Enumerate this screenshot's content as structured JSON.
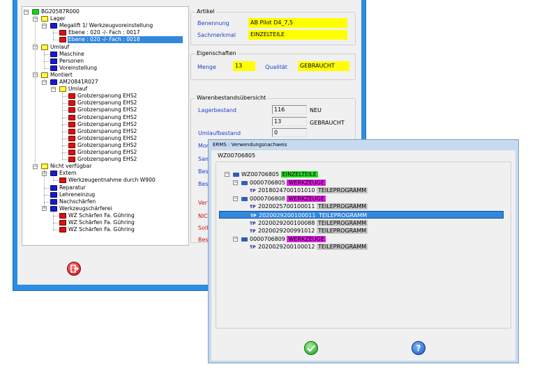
{
  "main": {
    "tree": {
      "items": [
        {
          "label": "BG20587R000",
          "indent": 0,
          "color": "g",
          "exp": "−"
        },
        {
          "label": "Lager",
          "indent": 1,
          "color": "y",
          "exp": "−"
        },
        {
          "label": "Megalift 1/ Werkzeugvoreinstellung",
          "indent": 2,
          "color": "b",
          "exp": "−"
        },
        {
          "label": "Ebene : 020 -/- Fach : 0017",
          "indent": 3,
          "color": "r",
          "exp": ""
        },
        {
          "label": "Ebene : 020 -/- Fach : 0018",
          "indent": 3,
          "color": "r",
          "exp": "",
          "selected": true
        },
        {
          "label": "Umlauf",
          "indent": 1,
          "color": "y",
          "exp": "−"
        },
        {
          "label": "Maschine",
          "indent": 2,
          "color": "b",
          "exp": ""
        },
        {
          "label": "Personen",
          "indent": 2,
          "color": "b",
          "exp": ""
        },
        {
          "label": "Voreinstellung",
          "indent": 2,
          "color": "b",
          "exp": ""
        },
        {
          "label": "Montiert",
          "indent": 1,
          "color": "y",
          "exp": "−"
        },
        {
          "label": "AM20841R027",
          "indent": 2,
          "color": "b",
          "exp": "−"
        },
        {
          "label": "Umlauf",
          "indent": 3,
          "color": "y",
          "exp": "−"
        },
        {
          "label": "Grobzerspanung EHS2",
          "indent": 4,
          "color": "r",
          "exp": ""
        },
        {
          "label": "Grobzerspanung EHS2",
          "indent": 4,
          "color": "r",
          "exp": ""
        },
        {
          "label": "Grobzerspanung EHS2",
          "indent": 4,
          "color": "r",
          "exp": ""
        },
        {
          "label": "Grobzerspanung EHS2",
          "indent": 4,
          "color": "r",
          "exp": ""
        },
        {
          "label": "Grobzerspanung EHS2",
          "indent": 4,
          "color": "r",
          "exp": ""
        },
        {
          "label": "Grobzerspanung EHS2",
          "indent": 4,
          "color": "r",
          "exp": ""
        },
        {
          "label": "Grobzerspanung EHS2",
          "indent": 4,
          "color": "r",
          "exp": ""
        },
        {
          "label": "Grobzerspanung EHS2",
          "indent": 4,
          "color": "r",
          "exp": ""
        },
        {
          "label": "Grobzerspanung EHS2",
          "indent": 4,
          "color": "r",
          "exp": ""
        },
        {
          "label": "Grobzerspanung EHS2",
          "indent": 4,
          "color": "r",
          "exp": ""
        },
        {
          "label": "Nicht verfügbar",
          "indent": 1,
          "color": "y",
          "exp": "−"
        },
        {
          "label": "Extern",
          "indent": 2,
          "color": "b",
          "exp": "−"
        },
        {
          "label": "Werkzeugentnahme durch W900",
          "indent": 3,
          "color": "r",
          "exp": ""
        },
        {
          "label": "Reparatur",
          "indent": 2,
          "color": "b",
          "exp": ""
        },
        {
          "label": "Lehreneinzug",
          "indent": 2,
          "color": "b",
          "exp": ""
        },
        {
          "label": "Nachschärfen",
          "indent": 2,
          "color": "b",
          "exp": ""
        },
        {
          "label": "Werkzeugschärferei",
          "indent": 2,
          "color": "b",
          "exp": "−"
        },
        {
          "label": "WZ Schärfen Fa. Gühring",
          "indent": 3,
          "color": "r",
          "exp": ""
        },
        {
          "label": "WZ Schärfen Fa. Gühring",
          "indent": 3,
          "color": "r",
          "exp": ""
        },
        {
          "label": "WZ Schärfen Fa. Gühring",
          "indent": 3,
          "color": "r",
          "exp": ""
        }
      ]
    },
    "artikel": {
      "title": "Artikel",
      "benennung_label": "Benennung",
      "benennung_value": "AB Pilot D4_7,5",
      "sachmerkmal_label": "Sachmerkmal",
      "sachmerkmal_value": "EINZELTEILE"
    },
    "eigenschaften": {
      "title": "Eigenschaften",
      "menge_label": "Menge",
      "menge_value": "13",
      "qualitaet_label": "Qualität",
      "qualitaet_value": "GEBRAUCHT"
    },
    "bestand": {
      "title": "Warenbestandsübersicht",
      "lagerbestand_label": "Lagerbestand",
      "lager_neu_value": "116",
      "neu_label": "NEU",
      "lager_gebraucht_value": "13",
      "gebraucht_label": "GEBRAUCHT",
      "umlaufbestand_label": "Umlaufbestand",
      "umlauf_value": "0",
      "partial_labels": [
        "Mon",
        "Sam",
        "Best",
        "Best"
      ],
      "partial_red_labels": [
        "Verf",
        "NICH",
        "Sollb",
        "Best"
      ]
    },
    "colors": {
      "label_blue": "#1c3fcf",
      "field_yellow": "#ffff00",
      "title_blue": "#2b8ee0"
    }
  },
  "dialog": {
    "title": "ERMS : Verwendungsnachweis",
    "group_title": "WZ00706805",
    "tree": [
      {
        "indent": 0,
        "icon": "tool",
        "exp": "−",
        "code": "WZ00706805",
        "tag": "EINZELTEILE",
        "tagcolor": "green"
      },
      {
        "indent": 1,
        "icon": "tool",
        "exp": "−",
        "code": "0000706805",
        "tag": "WERKZEUGE",
        "tagcolor": "mag"
      },
      {
        "indent": 2,
        "icon": "tp",
        "exp": "",
        "code": "2018024700101010",
        "tag": "TEILEPROGRAMM",
        "tagcolor": "gray"
      },
      {
        "indent": 1,
        "icon": "tool",
        "exp": "−",
        "code": "0000706808",
        "tag": "WERKZEUGE",
        "tagcolor": "mag"
      },
      {
        "indent": 2,
        "icon": "tp",
        "exp": "",
        "code": "2020025700100011",
        "tag": "TEILEPROGRAMM",
        "tagcolor": "gray"
      },
      {
        "indent": 2,
        "icon": "tp",
        "exp": "",
        "code": "2020029200100011",
        "tag": "TEILEPROGRAMM",
        "tagcolor": "gray",
        "selected": true
      },
      {
        "indent": 2,
        "icon": "tp",
        "exp": "",
        "code": "2020029200100088",
        "tag": "TEILEPROGRAMM",
        "tagcolor": "gray"
      },
      {
        "indent": 2,
        "icon": "tp",
        "exp": "",
        "code": "2020029200991012",
        "tag": "TEILEPROGRAMM",
        "tagcolor": "gray"
      },
      {
        "indent": 1,
        "icon": "tool",
        "exp": "−",
        "code": "0000706809",
        "tag": "WERKZEUGE",
        "tagcolor": "mag"
      },
      {
        "indent": 2,
        "icon": "tp",
        "exp": "",
        "code": "2020029200100012",
        "tag": "TEILEPROGRAMM",
        "tagcolor": "gray"
      }
    ],
    "tp_label": "TP",
    "icons": {
      "ok": "check-icon",
      "help": "help-icon",
      "exit": "exit-icon"
    }
  }
}
